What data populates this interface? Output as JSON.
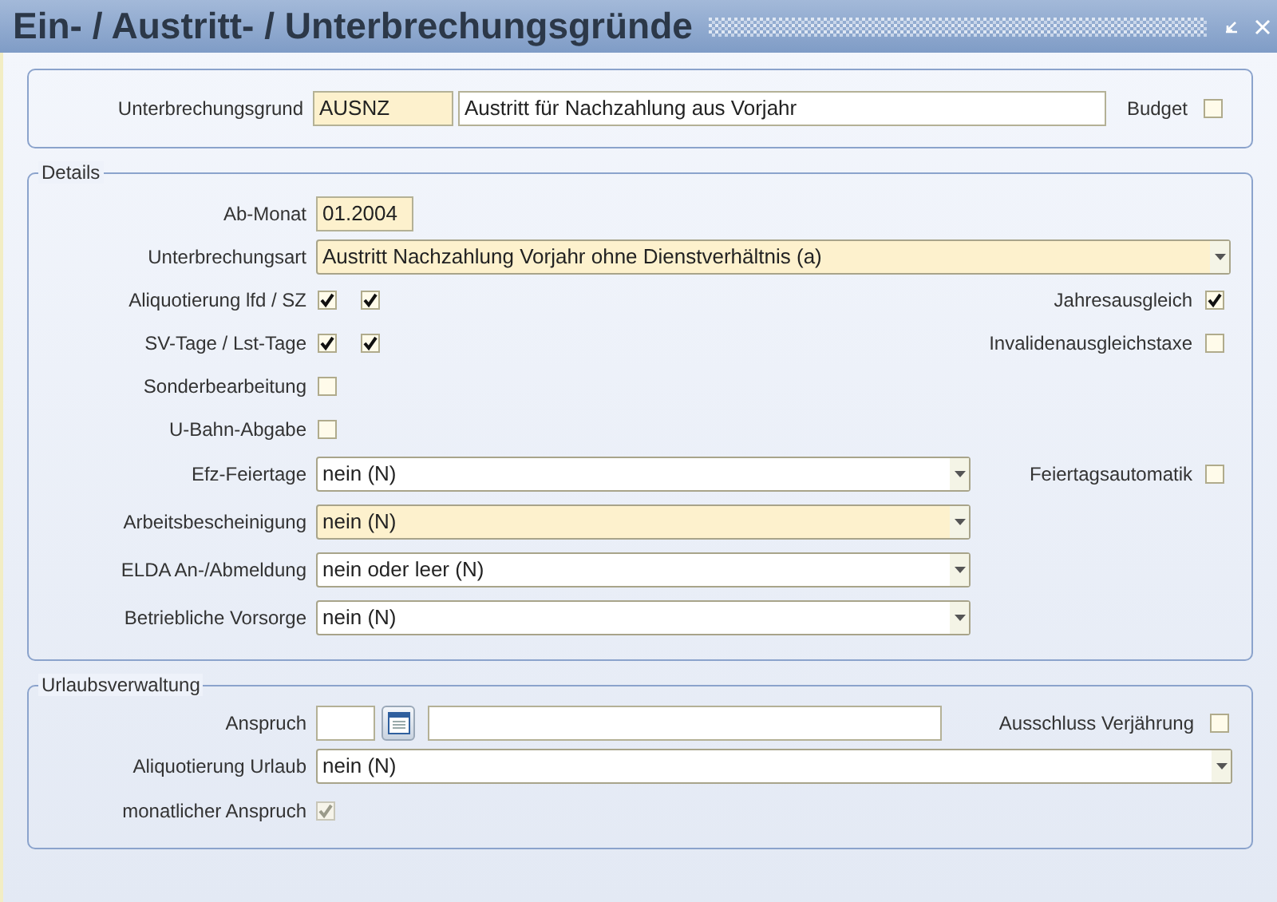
{
  "window": {
    "title": "Ein- / Austritt- / Unterbrechungsgründe"
  },
  "header": {
    "label": "Unterbrechungsgrund",
    "code": "AUSNZ",
    "name": "Austritt für Nachzahlung aus Vorjahr",
    "budget": {
      "label": "Budget",
      "checked": false
    }
  },
  "details": {
    "legend": "Details",
    "rows": [
      {
        "kind": "text",
        "label": "Ab-Monat",
        "value": "01.2004",
        "required": true
      },
      {
        "kind": "select_wide",
        "label": "Unterbrechungsart",
        "value": "Austritt Nachzahlung Vorjahr ohne Dienstverhältnis (a)",
        "required": true
      },
      {
        "kind": "checks",
        "label": "Aliquotierung lfd / SZ",
        "checks": [
          {
            "checked": true
          },
          {
            "checked": true
          }
        ],
        "right": {
          "label": "Jahresausgleich",
          "checked": true
        }
      },
      {
        "kind": "checks",
        "label": "SV-Tage / Lst-Tage",
        "checks": [
          {
            "checked": true
          },
          {
            "checked": true
          }
        ],
        "right": {
          "label": "Invalidenausgleichstaxe",
          "checked": false
        }
      },
      {
        "kind": "checks",
        "label": "Sonderbearbeitung",
        "checks": [
          {
            "checked": false
          }
        ]
      },
      {
        "kind": "checks",
        "label": "U-Bahn-Abgabe",
        "checks": [
          {
            "checked": false
          }
        ]
      },
      {
        "kind": "select",
        "label": "Efz-Feiertage",
        "value": "nein (N)",
        "required": false,
        "right": {
          "label": "Feiertagsautomatik",
          "checked": false
        }
      },
      {
        "kind": "select",
        "label": "Arbeitsbescheinigung",
        "value": "nein (N)",
        "required": true
      },
      {
        "kind": "select",
        "label": "ELDA An-/Abmeldung",
        "value": "nein oder leer (N)",
        "required": false
      },
      {
        "kind": "select",
        "label": "Betriebliche Vorsorge",
        "value": "nein (N)",
        "required": false
      }
    ]
  },
  "vacation": {
    "legend": "Urlaubsverwaltung",
    "anspruch_label": "Anspruch",
    "exclusion": {
      "label": "Ausschluss Verjährung",
      "checked": false
    },
    "aliquot": {
      "label": "Aliquotierung Urlaub",
      "value": "nein (N)"
    },
    "monthly": {
      "label": "monatlicher Anspruch",
      "checked": true,
      "disabled": true
    }
  }
}
